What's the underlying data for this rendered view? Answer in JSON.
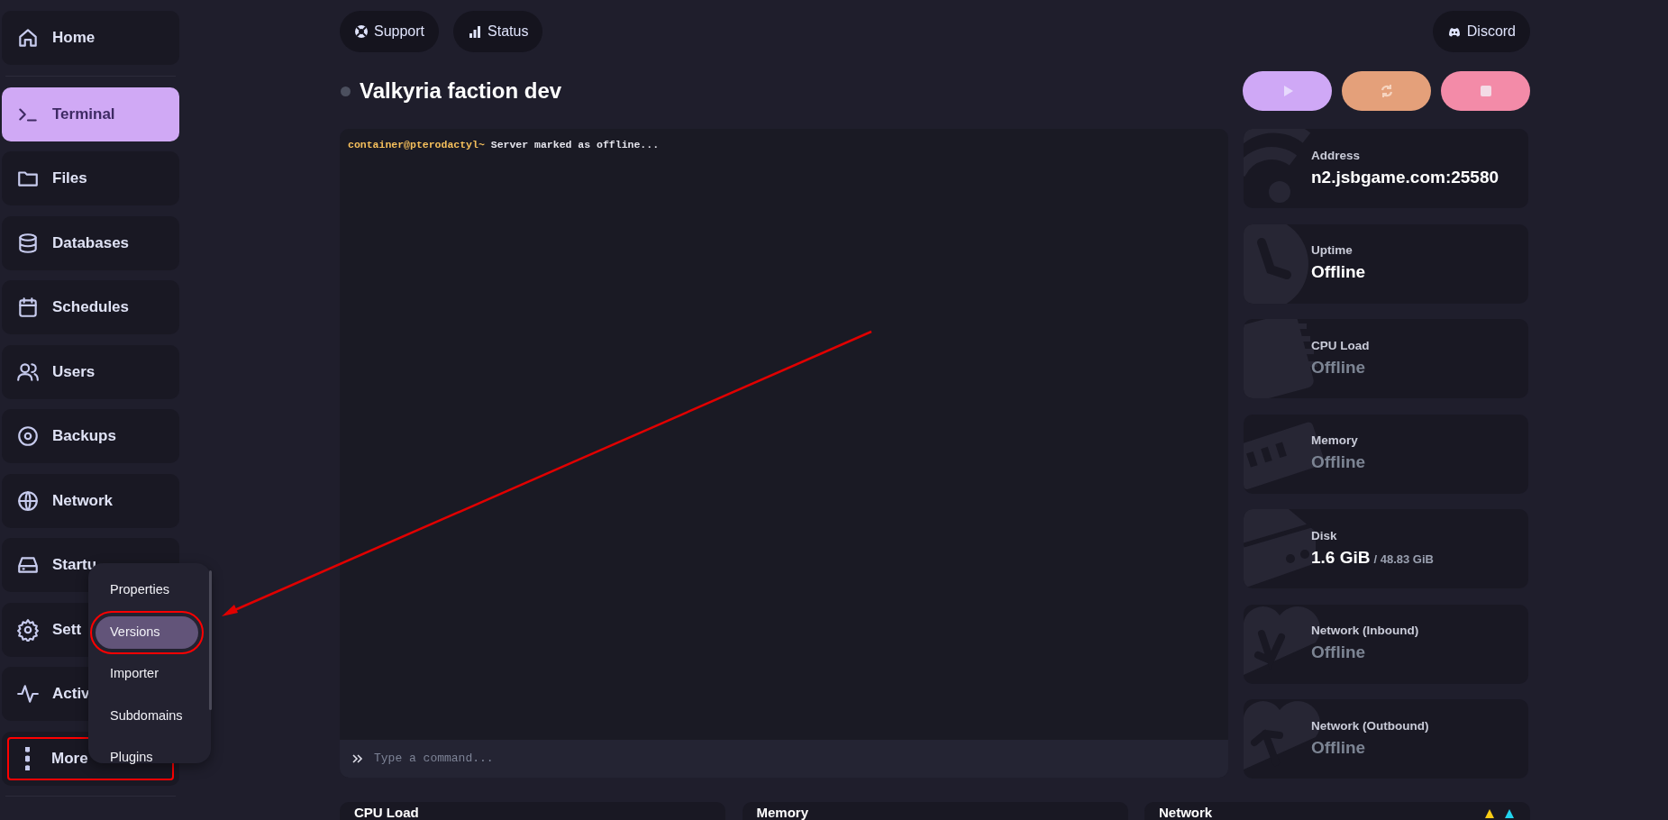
{
  "sidebar": {
    "items": [
      {
        "kind": "home",
        "label": "Home",
        "selected": false,
        "divider_after": true
      },
      {
        "kind": "terminal",
        "label": "Terminal",
        "selected": true
      },
      {
        "kind": "folder",
        "label": "Files",
        "selected": false
      },
      {
        "kind": "database",
        "label": "Databases",
        "selected": false
      },
      {
        "kind": "calendar",
        "label": "Schedules",
        "selected": false
      },
      {
        "kind": "users",
        "label": "Users",
        "selected": false
      },
      {
        "kind": "disc",
        "label": "Backups",
        "selected": false
      },
      {
        "kind": "globe",
        "label": "Network",
        "selected": false
      },
      {
        "kind": "drive",
        "label": "Startu",
        "selected": false
      },
      {
        "kind": "gear",
        "label": "Sett",
        "selected": false
      },
      {
        "kind": "activity",
        "label": "Activ",
        "selected": false
      },
      {
        "kind": "dots",
        "label": "More",
        "selected": false,
        "highlighted": true,
        "divider_after": true
      }
    ]
  },
  "more_menu": {
    "items": [
      {
        "label": "Properties",
        "selected": false,
        "highlighted": false
      },
      {
        "label": "Versions",
        "selected": true,
        "highlighted": true
      },
      {
        "label": "Importer",
        "selected": false,
        "highlighted": false
      },
      {
        "label": "Subdomains",
        "selected": false,
        "highlighted": false
      },
      {
        "label": "Plugins",
        "selected": false,
        "highlighted": false
      }
    ]
  },
  "header": {
    "links": [
      {
        "kind": "support",
        "label": "Support"
      },
      {
        "kind": "status",
        "label": "Status"
      }
    ],
    "right_links": [
      {
        "kind": "discord",
        "label": "Discord"
      }
    ]
  },
  "server": {
    "name": "Valkyria faction dev",
    "online": false
  },
  "power_buttons": [
    {
      "kind": "start"
    },
    {
      "kind": "restart"
    },
    {
      "kind": "stop"
    }
  ],
  "console": {
    "lines": [
      {
        "prompt": "container@pterodactyl~",
        "text": "Server marked as offline..."
      }
    ],
    "input": {
      "placeholder": "Type a command..."
    }
  },
  "stats": [
    {
      "kind": "address",
      "label": "Address",
      "value": "n2.jsbgame.com:25580",
      "muted": false
    },
    {
      "kind": "uptime",
      "label": "Uptime",
      "value": "Offline",
      "muted": false
    },
    {
      "kind": "cpu",
      "label": "CPU Load",
      "value": "Offline",
      "muted": true
    },
    {
      "kind": "memory",
      "label": "Memory",
      "value": "Offline",
      "muted": true
    },
    {
      "kind": "disk",
      "label": "Disk",
      "value": "1.6 GiB",
      "limit": "/ 48.83 GiB",
      "muted": false
    },
    {
      "kind": "inbound",
      "label": "Network (Inbound)",
      "value": "Offline",
      "muted": true
    },
    {
      "kind": "outbound",
      "label": "Network (Outbound)",
      "value": "Offline",
      "muted": true
    }
  ],
  "graphs": [
    {
      "title": "CPU Load",
      "legend": false
    },
    {
      "title": "Memory",
      "legend": false
    },
    {
      "title": "Network",
      "legend": true
    }
  ],
  "annotations": [
    {
      "kind": "arrow"
    }
  ]
}
